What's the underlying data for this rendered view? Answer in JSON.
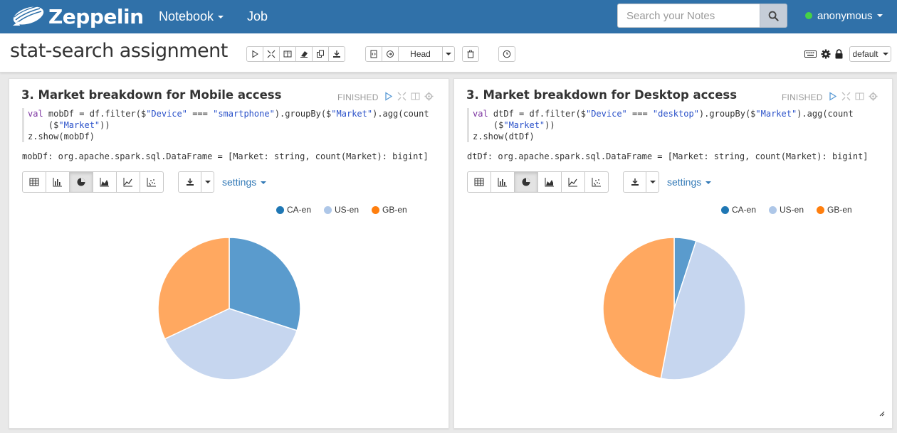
{
  "navbar": {
    "brand": "Zeppelin",
    "menu_notebook": "Notebook",
    "menu_job": "Job",
    "search_placeholder": "Search your Notes",
    "user": "anonymous"
  },
  "header": {
    "title": "stat-search assignment",
    "head_label": "Head",
    "default_label": "default"
  },
  "settings_label": "settings",
  "legend": [
    {
      "name": "CA-en",
      "color": "#1f77b4"
    },
    {
      "name": "US-en",
      "color": "#aec7e8"
    },
    {
      "name": "GB-en",
      "color": "#ff7f0e"
    }
  ],
  "pie_colors": {
    "CA-en": "#5a9bcd",
    "US-en": "#c6d6ef",
    "GB-en": "#ffa860"
  },
  "paragraphs": [
    {
      "title": "3. Market breakdown for Mobile access",
      "status": "FINISHED",
      "code_line1_a": "val",
      "code_line1_b": " mobDf = df.filter($",
      "code_line1_c": "\"Device\"",
      "code_line1_d": " === ",
      "code_line1_e": "\"smartphone\"",
      "code_line1_f": ").groupBy($",
      "code_line1_g": "\"Market\"",
      "code_line1_h": ").agg(count",
      "code_line2_a": "    ($",
      "code_line2_b": "\"Market\"",
      "code_line2_c": "))",
      "code_line3": "z.show(mobDf)",
      "result": "mobDf: org.apache.spark.sql.DataFrame = [Market: string, count(Market): bigint]"
    },
    {
      "title": "3. Market breakdown for Desktop access",
      "status": "FINISHED",
      "code_line1_a": "val",
      "code_line1_b": " dtDf = df.filter($",
      "code_line1_c": "\"Device\"",
      "code_line1_d": " === ",
      "code_line1_e": "\"desktop\"",
      "code_line1_f": ").groupBy($",
      "code_line1_g": "\"Market\"",
      "code_line1_h": ").agg(count",
      "code_line2_a": "    ($",
      "code_line2_b": "\"Market\"",
      "code_line2_c": "))",
      "code_line3": "z.show(dtDf)",
      "result": "dtDf: org.apache.spark.sql.DataFrame = [Market: string, count(Market): bigint]"
    }
  ],
  "chart_data": [
    {
      "type": "pie",
      "categories": [
        "CA-en",
        "US-en",
        "GB-en"
      ],
      "values": [
        0.3,
        0.38,
        0.32
      ]
    },
    {
      "type": "pie",
      "categories": [
        "CA-en",
        "US-en",
        "GB-en"
      ],
      "values": [
        0.05,
        0.48,
        0.47
      ]
    }
  ]
}
